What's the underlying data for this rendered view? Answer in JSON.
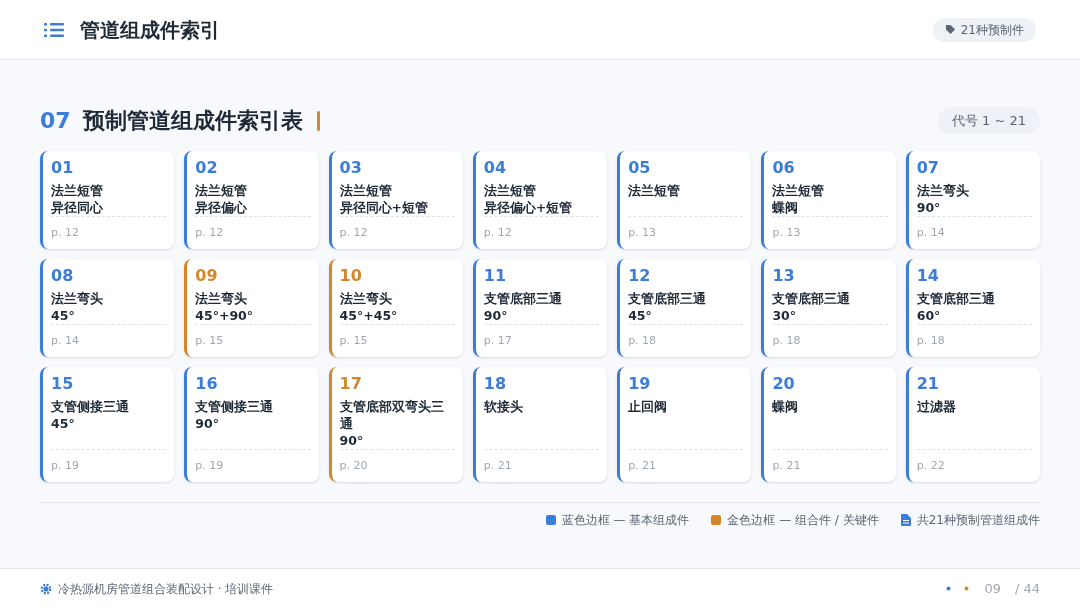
{
  "header": {
    "title": "管道组成件索引",
    "badge": "21种预制件"
  },
  "section": {
    "number": "07",
    "title": "预制管道组成件索引表",
    "range": "代号 1 ~ 21"
  },
  "cards": [
    {
      "code": "01",
      "lines": [
        "法兰短管",
        "异径同心"
      ],
      "page": "p. 12",
      "color": "#3b7dd8"
    },
    {
      "code": "02",
      "lines": [
        "法兰短管",
        "异径偏心"
      ],
      "page": "p. 12",
      "color": "#3b7dd8"
    },
    {
      "code": "03",
      "lines": [
        "法兰短管",
        "异径同心+短管"
      ],
      "page": "p. 12",
      "color": "#3b7dd8"
    },
    {
      "code": "04",
      "lines": [
        "法兰短管",
        "异径偏心+短管"
      ],
      "page": "p. 12",
      "color": "#3b7dd8"
    },
    {
      "code": "05",
      "lines": [
        "法兰短管"
      ],
      "page": "p. 13",
      "color": "#3b7dd8"
    },
    {
      "code": "06",
      "lines": [
        "法兰短管",
        "蝶阀"
      ],
      "page": "p. 13",
      "color": "#3b7dd8"
    },
    {
      "code": "07",
      "lines": [
        "法兰弯头",
        "90°"
      ],
      "page": "p. 14",
      "color": "#3b7dd8"
    },
    {
      "code": "08",
      "lines": [
        "法兰弯头",
        "45°"
      ],
      "page": "p. 14",
      "color": "#3b7dd8"
    },
    {
      "code": "09",
      "lines": [
        "法兰弯头",
        "45°+90°"
      ],
      "page": "p. 15",
      "color": "#d4872a"
    },
    {
      "code": "10",
      "lines": [
        "法兰弯头",
        "45°+45°"
      ],
      "page": "p. 15",
      "color": "#d4872a"
    },
    {
      "code": "11",
      "lines": [
        "支管底部三通",
        "90°"
      ],
      "page": "p. 17",
      "color": "#3b7dd8"
    },
    {
      "code": "12",
      "lines": [
        "支管底部三通",
        "45°"
      ],
      "page": "p. 18",
      "color": "#3b7dd8"
    },
    {
      "code": "13",
      "lines": [
        "支管底部三通",
        "30°"
      ],
      "page": "p. 18",
      "color": "#3b7dd8"
    },
    {
      "code": "14",
      "lines": [
        "支管底部三通",
        "60°"
      ],
      "page": "p. 18",
      "color": "#3b7dd8"
    },
    {
      "code": "15",
      "lines": [
        "支管侧接三通",
        "45°"
      ],
      "page": "p. 19",
      "color": "#3b7dd8"
    },
    {
      "code": "16",
      "lines": [
        "支管侧接三通",
        "90°"
      ],
      "page": "p. 19",
      "color": "#3b7dd8"
    },
    {
      "code": "17",
      "lines": [
        "支管底部双弯头三通",
        "90°"
      ],
      "page": "p. 20",
      "color": "#d4872a"
    },
    {
      "code": "18",
      "lines": [
        "软接头"
      ],
      "page": "p. 21",
      "color": "#3b7dd8"
    },
    {
      "code": "19",
      "lines": [
        "止回阀"
      ],
      "page": "p. 21",
      "color": "#3b7dd8"
    },
    {
      "code": "20",
      "lines": [
        "蝶阀"
      ],
      "page": "p. 21",
      "color": "#3b7dd8"
    },
    {
      "code": "21",
      "lines": [
        "过滤器"
      ],
      "page": "p. 22",
      "color": "#3b7dd8"
    }
  ],
  "legend": [
    {
      "kind": "swatch",
      "color": "#3b7dd8",
      "text": "蓝色边框 — 基本组成件"
    },
    {
      "kind": "swatch",
      "color": "#d4872a",
      "text": "金色边框 — 组合件 / 关键件"
    },
    {
      "kind": "doc",
      "text": "共21种预制管道组成件"
    }
  ],
  "footer": {
    "title": "冷热源机房管道组合装配设计 · 培训课件",
    "page": "09",
    "total": "/ 44"
  }
}
